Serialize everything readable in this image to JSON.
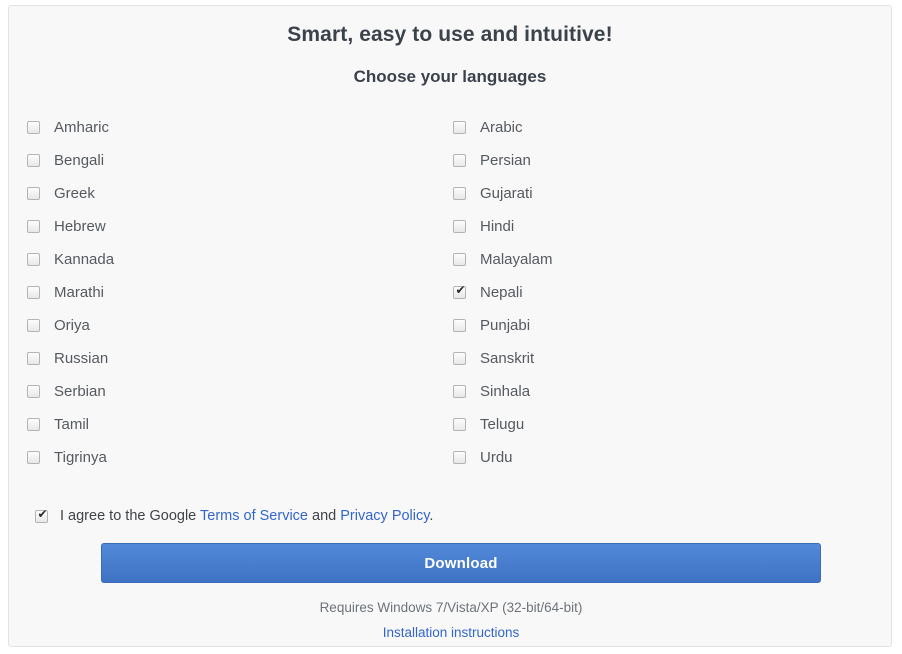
{
  "panel": {
    "title": "Smart, easy to use and intuitive!",
    "subtitle": "Choose your languages"
  },
  "languages": {
    "left_column": [
      {
        "label": "Amharic",
        "checked": false
      },
      {
        "label": "Bengali",
        "checked": false
      },
      {
        "label": "Greek",
        "checked": false
      },
      {
        "label": "Hebrew",
        "checked": false
      },
      {
        "label": "Kannada",
        "checked": false
      },
      {
        "label": "Marathi",
        "checked": false
      },
      {
        "label": "Oriya",
        "checked": false
      },
      {
        "label": "Russian",
        "checked": false
      },
      {
        "label": "Serbian",
        "checked": false
      },
      {
        "label": "Tamil",
        "checked": false
      },
      {
        "label": "Tigrinya",
        "checked": false
      }
    ],
    "right_column": [
      {
        "label": "Arabic",
        "checked": false
      },
      {
        "label": "Persian",
        "checked": false
      },
      {
        "label": "Gujarati",
        "checked": false
      },
      {
        "label": "Hindi",
        "checked": false
      },
      {
        "label": "Malayalam",
        "checked": false
      },
      {
        "label": "Nepali",
        "checked": true
      },
      {
        "label": "Punjabi",
        "checked": false
      },
      {
        "label": "Sanskrit",
        "checked": false
      },
      {
        "label": "Sinhala",
        "checked": false
      },
      {
        "label": "Telugu",
        "checked": false
      },
      {
        "label": "Urdu",
        "checked": false
      }
    ]
  },
  "terms": {
    "checked": true,
    "prefix": "I agree to the Google ",
    "tos_link": "Terms of Service",
    "middle": " and ",
    "privacy_link": "Privacy Policy",
    "suffix": "."
  },
  "download": {
    "label": "Download"
  },
  "footer": {
    "requires": "Requires Windows 7/Vista/XP (32-bit/64-bit)",
    "install_link": "Installation instructions"
  },
  "colors": {
    "button_blue": "#4a7ccc",
    "link_blue": "#3366cc",
    "heading": "#3c424b",
    "panel_bg": "#f8f8f8"
  }
}
